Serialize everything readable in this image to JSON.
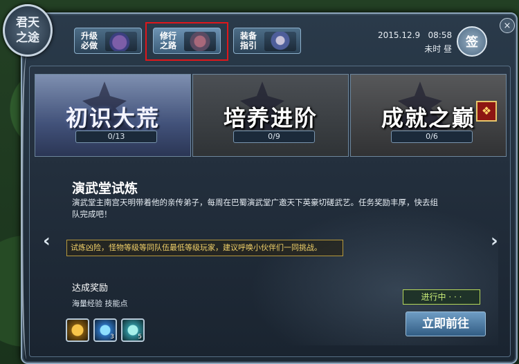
{
  "emblem": {
    "title": "君天之途"
  },
  "tabs": [
    {
      "label": "升级必做",
      "icon": "treasure-chest-icon"
    },
    {
      "label": "修行之路",
      "icon": "pagoda-icon",
      "active": true
    },
    {
      "label": "装备指引",
      "icon": "armor-icon"
    }
  ],
  "clock": {
    "date": "2015.12.9",
    "time": "08:58",
    "period": "未时",
    "day_phase": "昼"
  },
  "sign_label": "签",
  "close_label": "×",
  "cards": [
    {
      "title": "初识大荒",
      "progress": "0/13"
    },
    {
      "title": "培养进阶",
      "progress": "0/9"
    },
    {
      "title": "成就之巅",
      "progress": "0/6"
    }
  ],
  "task": {
    "title": "演武堂试炼",
    "description": "演武堂主南宫天明带着他的亲传弟子，每周在巴蜀演武堂广邀天下英豪切磋武艺。任务奖励丰厚，快去组队完成吧！",
    "warning": "试炼凶险，怪物等级等同队伍最低等级玩家，建议呼唤小伙伴们一同挑战。"
  },
  "reward": {
    "title": "达成奖励",
    "description": "海量经验 技能点",
    "items": [
      {
        "icon": "gold-ring-icon",
        "count": ""
      },
      {
        "icon": "blue-orb-icon",
        "count": "3"
      },
      {
        "icon": "jade-orb-icon",
        "count": "5"
      }
    ]
  },
  "status": "进行中 · · ·",
  "go_button": "立即前往",
  "nav": {
    "prev": "‹",
    "next": "›"
  },
  "gift_icon_glyph": "❖"
}
